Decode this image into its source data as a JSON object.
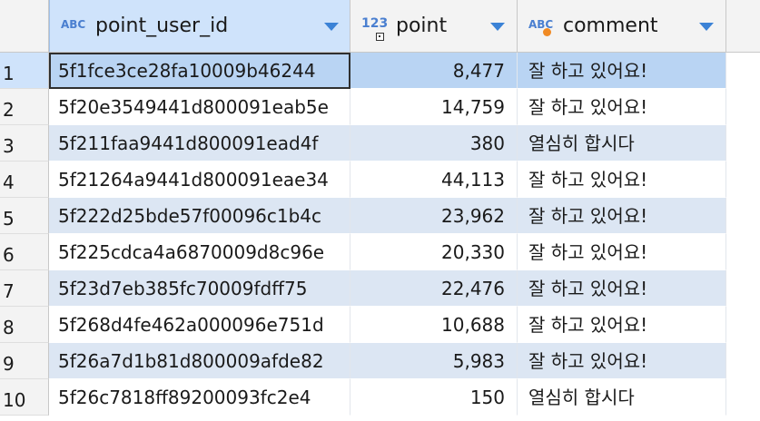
{
  "columns": [
    {
      "type_icon": "ABC",
      "label": "point_user_id"
    },
    {
      "type_icon": "123",
      "label": "point"
    },
    {
      "type_icon": "ABC",
      "label": "comment"
    }
  ],
  "rows": [
    {
      "num": "1",
      "point_user_id": "5f1fce3ce28fa10009b46244",
      "point": "8,477",
      "comment": "잘 하고 있어요!"
    },
    {
      "num": "2",
      "point_user_id": "5f20e3549441d800091eab5e",
      "point": "14,759",
      "comment": "잘 하고 있어요!"
    },
    {
      "num": "3",
      "point_user_id": "5f211faa9441d800091ead4f",
      "point": "380",
      "comment": "열심히 합시다"
    },
    {
      "num": "4",
      "point_user_id": "5f21264a9441d800091eae34",
      "point": "44,113",
      "comment": "잘 하고 있어요!"
    },
    {
      "num": "5",
      "point_user_id": "5f222d25bde57f00096c1b4c",
      "point": "23,962",
      "comment": "잘 하고 있어요!"
    },
    {
      "num": "6",
      "point_user_id": "5f225cdca4a6870009d8c96e",
      "point": "20,330",
      "comment": "잘 하고 있어요!"
    },
    {
      "num": "7",
      "point_user_id": "5f23d7eb385fc70009fdff75",
      "point": "22,476",
      "comment": "잘 하고 있어요!"
    },
    {
      "num": "8",
      "point_user_id": "5f268d4fe462a000096e751d",
      "point": "10,688",
      "comment": "잘 하고 있어요!"
    },
    {
      "num": "9",
      "point_user_id": "5f26a7d1b81d800009afde82",
      "point": "5,983",
      "comment": "잘 하고 있어요!"
    },
    {
      "num": "10",
      "point_user_id": "5f26c7818ff89200093fc2e4",
      "point": "150",
      "comment": "열심히 합시다"
    }
  ],
  "selected_row": 1,
  "colors": {
    "accent": "#3b82d6",
    "header_bg": "#f3f3f3",
    "selected_header_bg": "#cfe3fb",
    "band_odd": "#dce6f3",
    "band_selected": "#b9d4f3",
    "type_icon": "#4a7fd0",
    "string_marker": "#f08a24"
  }
}
